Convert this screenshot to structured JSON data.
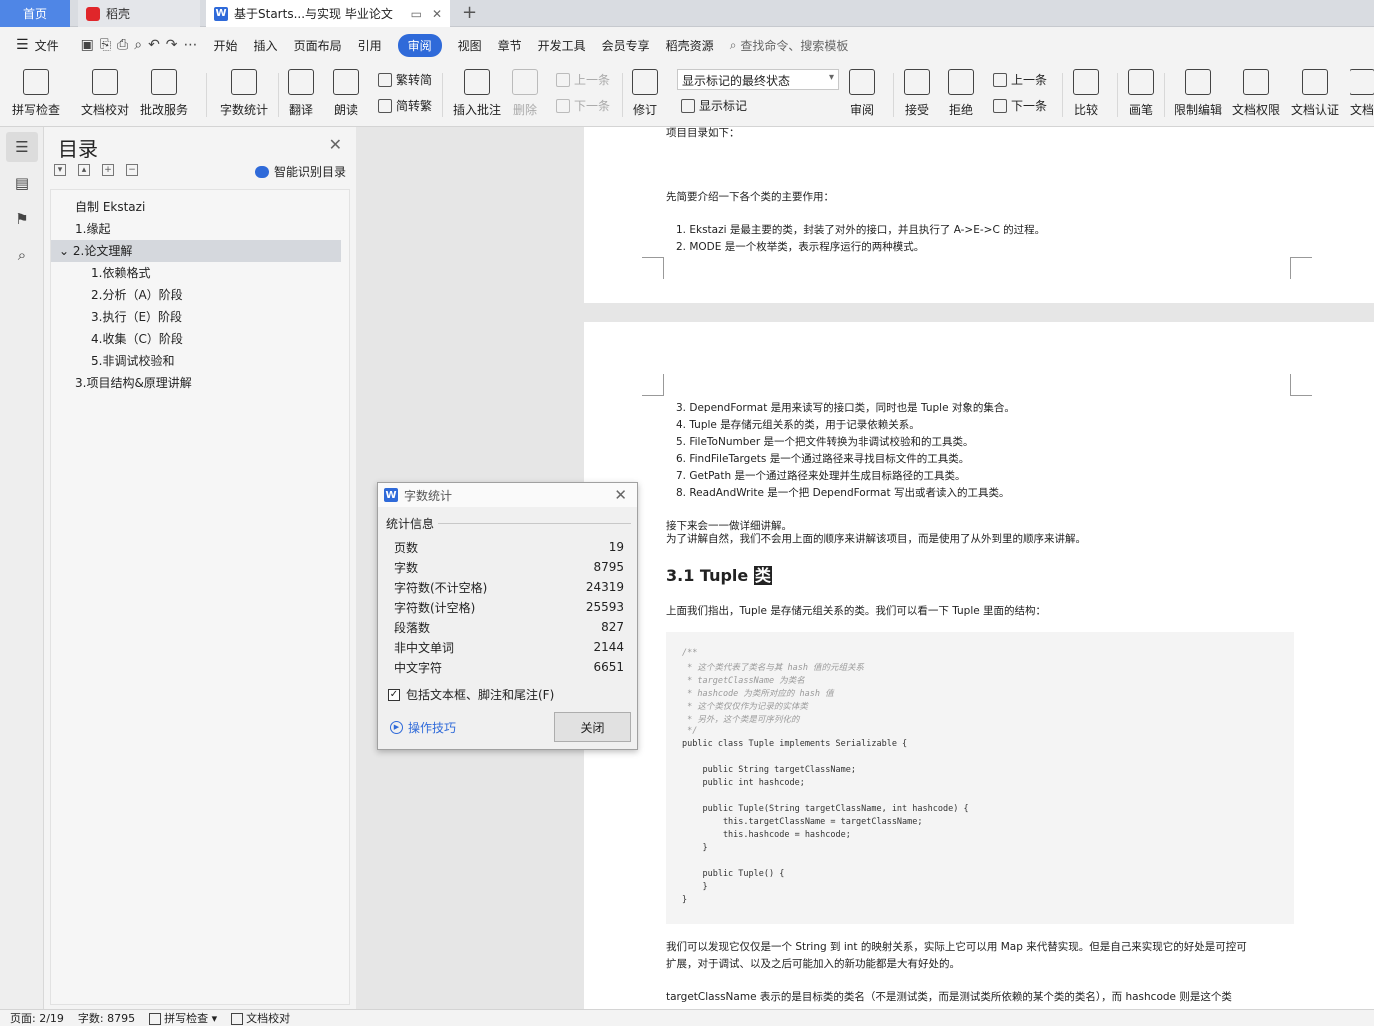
{
  "tabs": {
    "home": "首页",
    "daoke": "稻壳",
    "doc": "基于Starts...与实现 毕业论文"
  },
  "menu": {
    "file": "文件",
    "items": [
      "开始",
      "插入",
      "页面布局",
      "引用",
      "审阅",
      "视图",
      "章节",
      "开发工具",
      "会员专享",
      "稻壳资源"
    ],
    "active": "审阅",
    "search": "查找命令、搜索模板"
  },
  "ribbon": {
    "spell": "拼写检查",
    "proof": "文档校对",
    "review_service": "批改服务",
    "word_count": "字数统计",
    "translate": "翻译",
    "read_aloud": "朗读",
    "trad": "繁转简",
    "simp": "简转繁",
    "insert_comment": "插入批注",
    "delete": "删除",
    "prev": "上一条",
    "next": "下一条",
    "revise": "修订",
    "markup_select": "显示标记的最终状态",
    "show_markup": "显示标记",
    "review": "审阅",
    "accept": "接受",
    "reject": "拒绝",
    "prev2": "上一条",
    "next2": "下一条",
    "compare": "比较",
    "pen": "画笔",
    "restrict": "限制编辑",
    "perm": "文档权限",
    "cert": "文档认证",
    "more": "文档"
  },
  "toc": {
    "title": "目录",
    "smart": "智能识别目录",
    "items": [
      {
        "text": "自制 Ekstazi",
        "level": 1
      },
      {
        "text": "1.缘起",
        "level": 1
      },
      {
        "text": "2.论文理解",
        "level": 1,
        "selected": true
      },
      {
        "text": "1.依赖格式",
        "level": 2
      },
      {
        "text": "2.分析（A）阶段",
        "level": 2
      },
      {
        "text": "3.执行（E）阶段",
        "level": 2
      },
      {
        "text": "4.收集（C）阶段",
        "level": 2
      },
      {
        "text": "5.非调试校验和",
        "level": 2
      },
      {
        "text": "3.项目结构&原理讲解",
        "level": 1
      }
    ]
  },
  "doc": {
    "p1_top": "项目目录如下：",
    "p1_intro": "先简要介绍一下各个类的主要作用：",
    "p1_list": [
      "1. Ekstazi 是最主要的类，封装了对外的接口，并且执行了 A->E->C 的过程。",
      "2. MODE 是一个枚举类，表示程序运行的两种模式。"
    ],
    "p2_list": [
      "3. DependFormat 是用来读写的接口类，同时也是 Tuple 对象的集合。",
      "4. Tuple 是存储元组关系的类，用于记录依赖关系。",
      "5. FileToNumber 是一个把文件转换为非调试校验和的工具类。",
      "6. FindFileTargets 是一个通过路径来寻找目标文件的工具类。",
      "7. GetPath 是一个通过路径来处理并生成目标路径的工具类。",
      "8. ReadAndWrite 是一个把 DependFormat 写出或者读入的工具类。"
    ],
    "p2_para1": "接下来会一一做详细讲解。",
    "p2_para2": "为了讲解自然，我们不会用上面的顺序来讲解该项目，而是使用了从外到里的顺序来讲解。",
    "heading": "3.1 Tuple ",
    "heading_hl": "类",
    "p2_para3": "上面我们指出，Tuple 是存储元组关系的类。我们可以看一下 Tuple 里面的结构：",
    "code_comments": [
      "/**",
      " * 这个类代表了类名与其 hash 值的元组关系",
      " * targetClassName 为类名",
      " * hashcode 为类所对应的 hash 值",
      " * 这个类仅仅作为记录的实体类",
      " * 另外，这个类是可序列化的",
      " */"
    ],
    "code_lines": [
      "public class Tuple implements Serializable {",
      "    public String targetClassName;",
      "    public int hashcode;",
      "    public Tuple(String targetClassName, int hashcode) {",
      "        this.targetClassName = targetClassName;",
      "        this.hashcode = hashcode;",
      "    }",
      "    public Tuple() {",
      "    }",
      "}"
    ],
    "p2_para4a": "我们可以发现它仅仅是一个 String 到 int 的映射关系，实际上它可以用 Map 来代替实现。但是自己来实现它的好处是可控可",
    "p2_para4b": "扩展，对于调试、以及之后可能加入的新功能都是大有好处的。",
    "p2_para5": "targetClassName 表示的是目标类的类名（不是测试类，而是测试类所依赖的某个类的类名），而 hashcode 则是这个类"
  },
  "dialog": {
    "title": "字数统计",
    "section": "统计信息",
    "rows": [
      {
        "label": "页数",
        "value": "19"
      },
      {
        "label": "字数",
        "value": "8795"
      },
      {
        "label": "字符数(不计空格)",
        "value": "24319"
      },
      {
        "label": "字符数(计空格)",
        "value": "25593"
      },
      {
        "label": "段落数",
        "value": "827"
      },
      {
        "label": "非中文单词",
        "value": "2144"
      },
      {
        "label": "中文字符",
        "value": "6651"
      }
    ],
    "checkbox": "包括文本框、脚注和尾注(F)",
    "tips": "操作技巧",
    "close": "关闭"
  },
  "status": {
    "page": "页面: 2/19",
    "words": "字数: 8795",
    "spell": "拼写检查",
    "proof": "文档校对"
  },
  "colors": {
    "accent": "#2f6ad9",
    "home_tab": "#4f86e6"
  }
}
